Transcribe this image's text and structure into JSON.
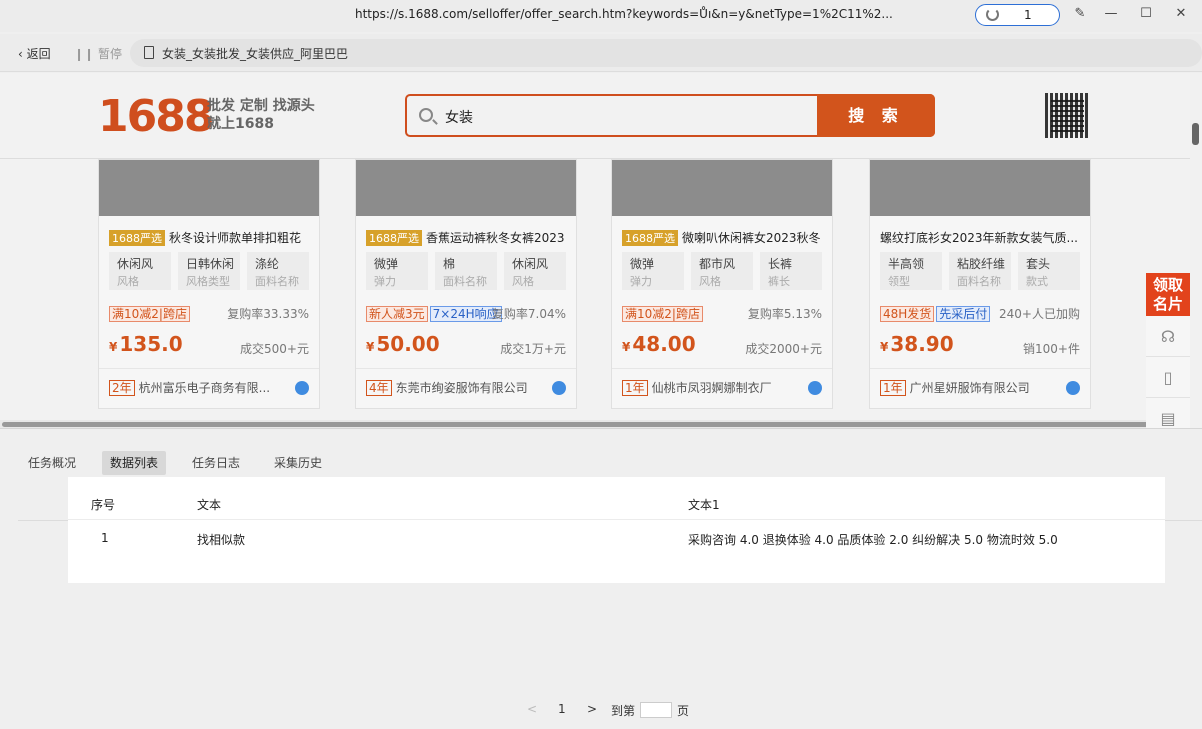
{
  "browser": {
    "url": "https://s.1688.com/selloffer/offer_search.htm?keywords=Ůı&n=y&netType=1%2C11%2...",
    "counter": "1",
    "back_label": "返回",
    "pause_label": "暂停",
    "page_title": "女装_女装批发_女装供应_阿里巴巴"
  },
  "site": {
    "logo": "1688",
    "slogan_line1": "批发 定制 找源头",
    "slogan_line2": "就上1688",
    "search_value": "女装",
    "search_button": "搜 索"
  },
  "products": [
    {
      "tag": "1688严选",
      "title": "秋冬设计师款单排扣粗花",
      "attrs": [
        {
          "v": "休闲风",
          "k": "风格"
        },
        {
          "v": "日韩休闲",
          "k": "风格类型"
        },
        {
          "v": "涤纶",
          "k": "面料名称"
        }
      ],
      "promo1": "满10减2|跨店",
      "promo2": "",
      "rate": "复购率33.33%",
      "price": "135.0",
      "sold": "成交500+元",
      "years": "2年",
      "shop": "杭州富乐电子商务有限..."
    },
    {
      "tag": "1688严选",
      "title": "香蕉运动裤秋冬女裤2023",
      "attrs": [
        {
          "v": "微弹",
          "k": "弹力"
        },
        {
          "v": "棉",
          "k": "面料名称"
        },
        {
          "v": "休闲风",
          "k": "风格"
        }
      ],
      "promo1": "新人减3元",
      "promo2": "7×24H响应",
      "rate": "复购率7.04%",
      "price": "50.00",
      "sold": "成交1万+元",
      "years": "4年",
      "shop": "东莞市绚姿服饰有限公司"
    },
    {
      "tag": "1688严选",
      "title": "微喇叭休闲裤女2023秋冬",
      "attrs": [
        {
          "v": "微弹",
          "k": "弹力"
        },
        {
          "v": "都市风",
          "k": "风格"
        },
        {
          "v": "长裤",
          "k": "裤长"
        }
      ],
      "promo1": "满10减2|跨店",
      "promo2": "",
      "rate": "复购率5.13%",
      "price": "48.00",
      "sold": "成交2000+元",
      "years": "1年",
      "shop": "仙桃市凤羽婀娜制衣厂"
    },
    {
      "tag": "",
      "title": "螺纹打底衫女2023年新款女装气质...",
      "attrs": [
        {
          "v": "半高领",
          "k": "领型"
        },
        {
          "v": "粘胶纤维",
          "k": "面料名称"
        },
        {
          "v": "套头",
          "k": "款式"
        }
      ],
      "promo1": "48H发货",
      "promo2": "先采后付",
      "rate": "240+人已加购",
      "price": "38.90",
      "sold": "销100+件",
      "years": "1年",
      "shop": "广州星妍服饰有限公司"
    }
  ],
  "price_currency": "¥",
  "sidebar": {
    "claim_line1": "领取",
    "claim_line2": "名片"
  },
  "panel": {
    "tabs": [
      "任务概况",
      "数据列表",
      "任务日志",
      "采集历史"
    ],
    "active_tab": 1,
    "columns": [
      "序号",
      "文本",
      "文本1"
    ],
    "rows": [
      {
        "index": "1",
        "text": "找相似款",
        "text1": "采购咨询 4.0 退换体验 4.0 品质体验 2.0 纠纷解决 5.0 物流时效 5.0"
      }
    ],
    "pager": {
      "prev": "<",
      "page": "1",
      "next": ">",
      "goto_label": "到第",
      "page_suffix": "页"
    }
  },
  "colors": {
    "brand": "#d2541c",
    "sidebar_top": "#f07d1a",
    "link_blue": "#2d6fd6"
  }
}
